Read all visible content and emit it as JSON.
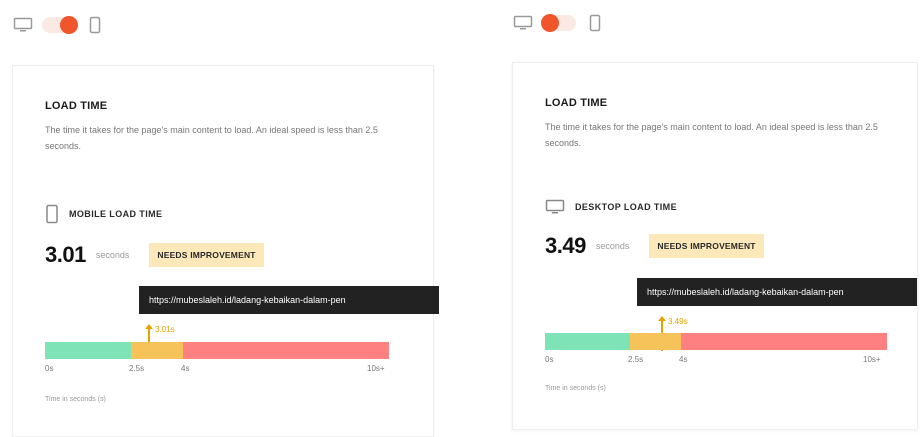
{
  "panels": {
    "mobile": {
      "card": {
        "title": "LOAD TIME",
        "description": "The time it takes for the page's main content to load. An ideal speed is less than 2.5 seconds."
      },
      "sub_title": "MOBILE LOAD TIME",
      "value": "3.01",
      "unit": "seconds",
      "badge": "NEEDS IMPROVEMENT",
      "tooltip": "https://mubeslaleh.id/ladang-kebaikan-dalam-pen",
      "marker_label": "3.01s",
      "ticks": [
        "0s",
        "2.5s",
        "4s",
        "10s+"
      ],
      "axis_caption": "Time in seconds (s)"
    },
    "desktop": {
      "card": {
        "title": "LOAD TIME",
        "description": "The time it takes for the page's main content to load. An ideal speed is less than 2.5 seconds."
      },
      "sub_title": "DESKTOP LOAD TIME",
      "value": "3.49",
      "unit": "seconds",
      "badge": "NEEDS IMPROVEMENT",
      "tooltip": "https://mubeslaleh.id/ladang-kebaikan-dalam-pen",
      "marker_label": "3.49s",
      "ticks": [
        "0s",
        "2.5s",
        "4s",
        "10s+"
      ],
      "axis_caption": "Time in seconds (s)"
    }
  },
  "colors": {
    "accent": "#f0552b",
    "good": "#7ee3b7",
    "needs_improvement": "#f6c25a",
    "poor": "#ff8080",
    "badge_bg": "#fde8b9"
  }
}
